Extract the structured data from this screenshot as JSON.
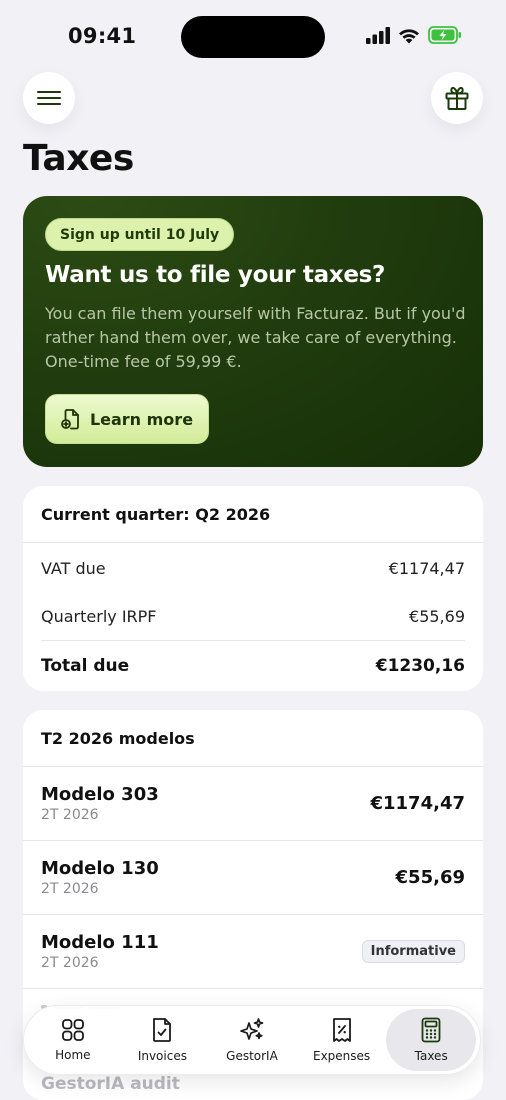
{
  "status_bar": {
    "time": "09:41"
  },
  "header": {
    "title": "Taxes"
  },
  "promo": {
    "chip": "Sign up until 10 July",
    "title": "Want us to file your taxes?",
    "body": "You can file them yourself with Facturaz. But if you'd rather hand them over, we take care of everything. One-time fee of 59,99 €.",
    "button_label": "Learn more"
  },
  "quarter": {
    "title": "Current quarter: Q2 2026",
    "rows": [
      {
        "label": "VAT due",
        "value": "€1174,47"
      },
      {
        "label": "Quarterly IRPF",
        "value": "€55,69"
      }
    ],
    "total": {
      "label": "Total due",
      "value": "€1230,16"
    }
  },
  "modelos": {
    "title": "T2 2026 modelos",
    "items": [
      {
        "name": "Modelo 303",
        "period": "2T 2026",
        "amount": "€1174,47"
      },
      {
        "name": "Modelo 130",
        "period": "2T 2026",
        "amount": "€55,69"
      },
      {
        "name": "Modelo 111",
        "period": "2T 2026",
        "badge": "Informative"
      }
    ]
  },
  "audit_peek": "GestorIA audit",
  "tabbar": {
    "tabs": [
      {
        "label": "Home",
        "icon": "home-grid-icon"
      },
      {
        "label": "Invoices",
        "icon": "invoice-document-icon"
      },
      {
        "label": "GestorIA",
        "icon": "sparkles-icon"
      },
      {
        "label": "Expenses",
        "icon": "receipt-percent-icon"
      },
      {
        "label": "Taxes",
        "icon": "calculator-icon",
        "active": true
      }
    ]
  },
  "colors": {
    "background": "#f1f1f6",
    "promo_bg": "#213d0e",
    "promo_accent": "#dcf1ab",
    "battery_green": "#3ec23e"
  }
}
